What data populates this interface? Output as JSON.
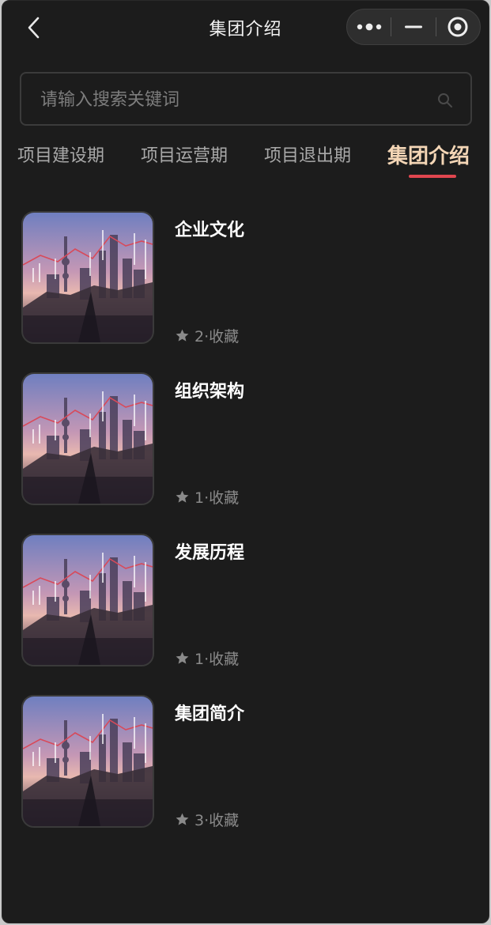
{
  "header": {
    "title": "集团介绍"
  },
  "search": {
    "placeholder": "请输入搜索关键词"
  },
  "tabs": [
    {
      "label": "项目建设期",
      "active": false
    },
    {
      "label": "项目运营期",
      "active": false
    },
    {
      "label": "项目退出期",
      "active": false
    },
    {
      "label": "集团介绍",
      "active": true
    }
  ],
  "items": [
    {
      "title": "企业文化",
      "meta": "2·收藏"
    },
    {
      "title": "组织架构",
      "meta": "1·收藏"
    },
    {
      "title": "发展历程",
      "meta": "1·收藏"
    },
    {
      "title": "集团简介",
      "meta": "3·收藏"
    }
  ],
  "colors": {
    "background": "#1c1c1c",
    "active_tab": "#f4d6b6",
    "tab_underline": "#e0464f"
  }
}
